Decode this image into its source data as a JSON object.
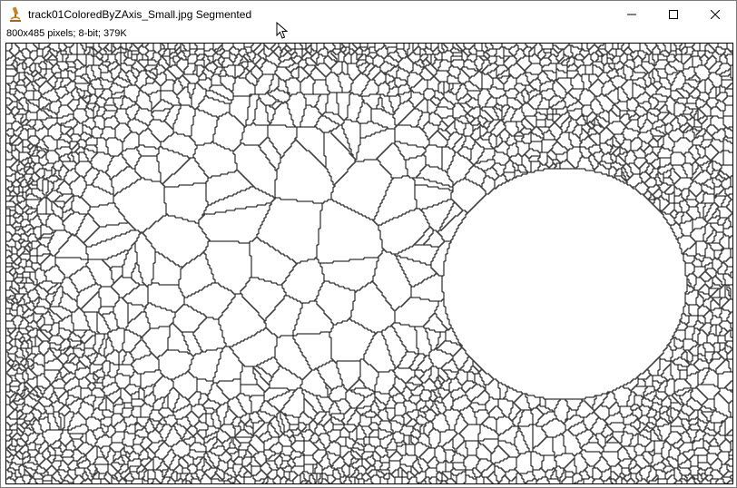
{
  "window": {
    "title": "track01ColoredByZAxis_Small.jpg Segmented",
    "app_icon": "microscope-icon",
    "controls": [
      "minimize-icon",
      "maximize-icon",
      "close-icon"
    ]
  },
  "info": {
    "text": "800x485 pixels; 8-bit; 379K"
  },
  "image": {
    "content": "segmented-voronoi-cells",
    "line_color": "#000000",
    "background_color": "#ffffff"
  },
  "colors": {
    "icon_accent": "#c8821e",
    "frame": "#000000"
  }
}
